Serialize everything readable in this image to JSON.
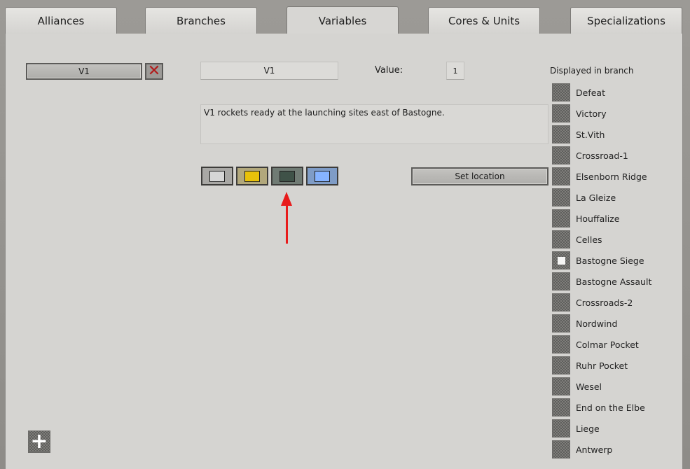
{
  "tabs": [
    {
      "label": "Alliances"
    },
    {
      "label": "Branches"
    },
    {
      "label": "Variables",
      "active": true
    },
    {
      "label": "Cores & Units"
    },
    {
      "label": "Specializations"
    }
  ],
  "variable_list": {
    "selected_item": "V1",
    "delete_icon": "close-x-icon"
  },
  "editor": {
    "name_value": "V1",
    "value_label": "Value:",
    "value_value": "1",
    "description": "V1 rockets ready at the launching sites east of Bastogne.",
    "colors": [
      {
        "name": "light-gray",
        "hex": "#d6d6d6"
      },
      {
        "name": "yellow",
        "hex": "#e8c10a"
      },
      {
        "name": "dark-green-gray",
        "hex": "#3f5248"
      },
      {
        "name": "light-blue",
        "hex": "#86b3ff"
      }
    ],
    "set_location_label": "Set location"
  },
  "branches": {
    "title": "Displayed in branch",
    "items": [
      {
        "label": "Defeat",
        "checked": false
      },
      {
        "label": "Victory",
        "checked": false
      },
      {
        "label": "St.Vith",
        "checked": false
      },
      {
        "label": "Crossroad-1",
        "checked": false
      },
      {
        "label": "Elsenborn Ridge",
        "checked": false
      },
      {
        "label": "La Gleize",
        "checked": false
      },
      {
        "label": "Houffalize",
        "checked": false
      },
      {
        "label": "Celles",
        "checked": false
      },
      {
        "label": "Bastogne Siege",
        "checked": true
      },
      {
        "label": "Bastogne Assault",
        "checked": false
      },
      {
        "label": "Crossroads-2",
        "checked": false
      },
      {
        "label": "Nordwind",
        "checked": false
      },
      {
        "label": "Colmar Pocket",
        "checked": false
      },
      {
        "label": "Ruhr Pocket",
        "checked": false
      },
      {
        "label": "Wesel",
        "checked": false
      },
      {
        "label": "End on the Elbe",
        "checked": false
      },
      {
        "label": "Liege",
        "checked": false
      },
      {
        "label": "Antwerp",
        "checked": false
      }
    ]
  },
  "add_button": {
    "icon": "plus-icon"
  },
  "annotation": {
    "color": "#e81b1b",
    "icon": "red-arrow-up-icon"
  }
}
